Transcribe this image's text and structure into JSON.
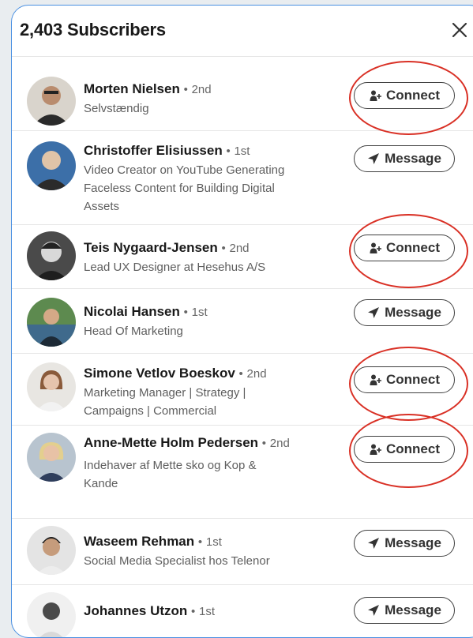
{
  "header": {
    "title": "2,403 Subscribers"
  },
  "subscribers": [
    {
      "name": "Morten Nielsen",
      "degree": "2nd",
      "headline": "Selvstændig",
      "action": "Connect"
    },
    {
      "name": "Christoffer Elisiussen",
      "degree": "1st",
      "headline": "Video Creator on YouTube Generating Faceless Content for Building Digital Assets",
      "action": "Message"
    },
    {
      "name": "Teis Nygaard-Jensen",
      "degree": "2nd",
      "headline": "Lead UX Designer at Hesehus A/S",
      "action": "Connect"
    },
    {
      "name": "Nicolai Hansen",
      "degree": "1st",
      "headline": "Head Of Marketing",
      "action": "Message"
    },
    {
      "name": "Simone Vetlov Boeskov",
      "degree": "2nd",
      "headline": "Marketing Manager | Strategy | Campaigns | Commercial",
      "action": "Connect"
    },
    {
      "name": "Anne-Mette Holm Pedersen",
      "degree": "2nd",
      "headline": "Indehaver af Mette sko og Kop & Kande",
      "action": "Connect"
    },
    {
      "name": "Waseem Rehman",
      "degree": "1st",
      "headline": "Social Media Specialist hos Telenor",
      "action": "Message"
    },
    {
      "name": "Johannes Utzon",
      "degree": "1st",
      "headline": "",
      "action": "Message"
    }
  ],
  "separator": "•",
  "colors": {
    "annotation": "#d93025",
    "modal_border": "#4a90e2",
    "button_text": "#333333"
  },
  "icons": {
    "close": "close-icon",
    "connect": "add-person-icon",
    "message": "send-message-icon"
  }
}
